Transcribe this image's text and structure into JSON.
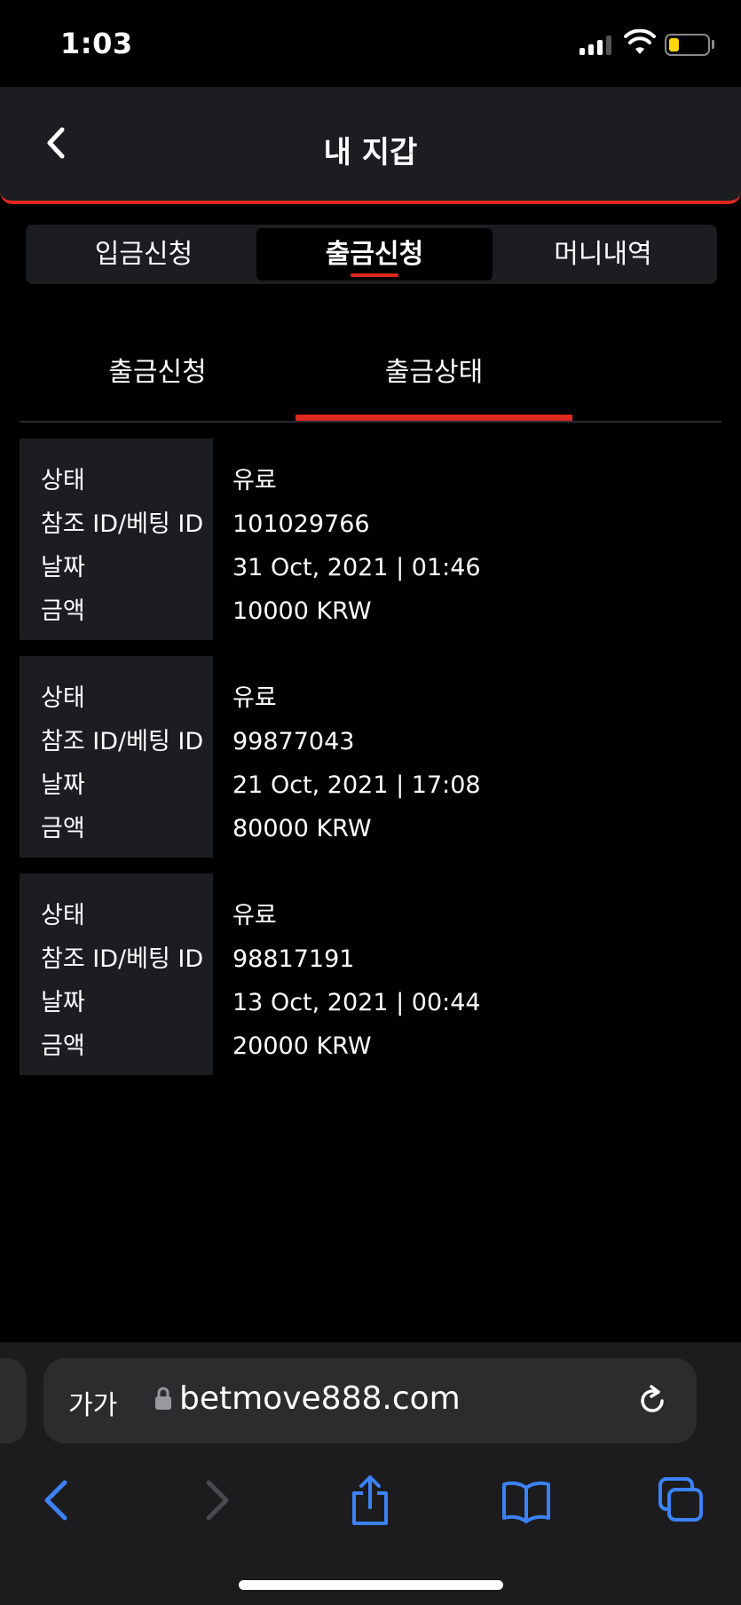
{
  "status_bar": {
    "time": "1:03"
  },
  "header": {
    "title": "내 지갑"
  },
  "top_tabs": [
    {
      "label": "입금신청",
      "active": false
    },
    {
      "label": "출금신청",
      "active": true
    },
    {
      "label": "머니내역",
      "active": false
    }
  ],
  "sub_tabs": [
    {
      "label": "출금신청",
      "active": false
    },
    {
      "label": "출금상태",
      "active": true
    }
  ],
  "record_labels": {
    "status": "상태",
    "ref_id": "참조 ID/베팅 ID",
    "date": "날짜",
    "amount": "금액"
  },
  "records": [
    {
      "status": "유료",
      "ref_id": "101029766",
      "date": "31 Oct, 2021 | 01:46",
      "amount": "10000 KRW"
    },
    {
      "status": "유료",
      "ref_id": "99877043",
      "date": "21 Oct, 2021 | 17:08",
      "amount": "80000 KRW"
    },
    {
      "status": "유료",
      "ref_id": "98817191",
      "date": "13 Oct, 2021 | 00:44",
      "amount": "20000 KRW"
    }
  ],
  "browser": {
    "text_size_label": "가가",
    "url": "betmove888.com"
  },
  "colors": {
    "accent": "#e0281e",
    "panel": "#1c1d21",
    "link_blue": "#3b82f6"
  },
  "icons": [
    "back-chevron-icon",
    "signal-icon",
    "wifi-icon",
    "battery-icon",
    "lock-icon",
    "reload-icon",
    "browser-back-icon",
    "browser-forward-icon",
    "share-icon",
    "bookmarks-icon",
    "tabs-icon"
  ]
}
